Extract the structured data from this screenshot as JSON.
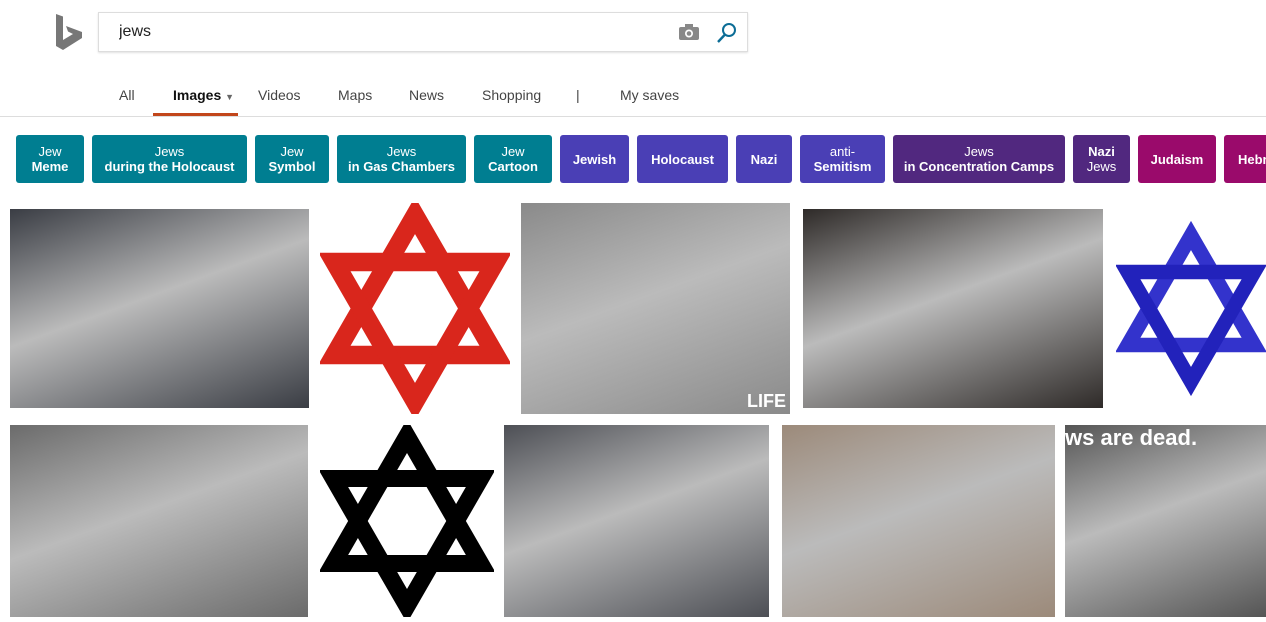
{
  "search": {
    "query": "jews"
  },
  "nav": {
    "items": [
      "All",
      "Images",
      "Videos",
      "Maps",
      "News",
      "Shopping",
      "|",
      "My saves"
    ],
    "active": "Images"
  },
  "colors": {
    "teal": "#007e91",
    "blue": "#4a3fb5",
    "purple": "#51287f",
    "magenta": "#9a0a6b",
    "accent": "#c2461b"
  },
  "chips": [
    {
      "top": "Jew",
      "bottom": "Meme",
      "color": "teal"
    },
    {
      "top": "Jews",
      "bottom": "during the Holocaust",
      "color": "teal"
    },
    {
      "top": "Jew",
      "bottom": "Symbol",
      "color": "teal"
    },
    {
      "top": "Jews",
      "bottom": "in Gas Chambers",
      "color": "teal"
    },
    {
      "top": "Jew",
      "bottom": "Cartoon",
      "color": "teal"
    },
    {
      "top": "",
      "bottom": "Jewish",
      "color": "blue"
    },
    {
      "top": "",
      "bottom": "Holocaust",
      "color": "blue"
    },
    {
      "top": "",
      "bottom": "Nazi",
      "color": "blue"
    },
    {
      "top": "anti-",
      "bottom": "Semitism",
      "color": "blue"
    },
    {
      "top": "Jews",
      "bottom": "in Concentration Camps",
      "color": "purple"
    },
    {
      "top": "Nazi",
      "bottom": "Jews",
      "color": "purple",
      "boldTop": true
    },
    {
      "top": "",
      "bottom": "Judaism",
      "color": "magenta"
    },
    {
      "top": "",
      "bottom": "Hebr",
      "color": "magenta"
    }
  ],
  "images": [
    {
      "desc": "photo",
      "tone": "#3a3d44"
    },
    {
      "desc": "red-star-of-david",
      "tone": "#d9261c"
    },
    {
      "desc": "photo",
      "tone": "#8a8a8a",
      "caption": "LIFE"
    },
    {
      "desc": "photo",
      "tone": "#2e2a28"
    },
    {
      "desc": "blue-star-of-david",
      "tone": "#3333cc"
    },
    {
      "desc": "photo",
      "tone": "#6b6b6b"
    },
    {
      "desc": "black-star-of-david",
      "tone": "#000000"
    },
    {
      "desc": "photo",
      "tone": "#4d4f55"
    },
    {
      "desc": "photo",
      "tone": "#9c8a7a"
    },
    {
      "desc": "photo",
      "tone": "#555555",
      "caption": "ws are dead."
    }
  ]
}
